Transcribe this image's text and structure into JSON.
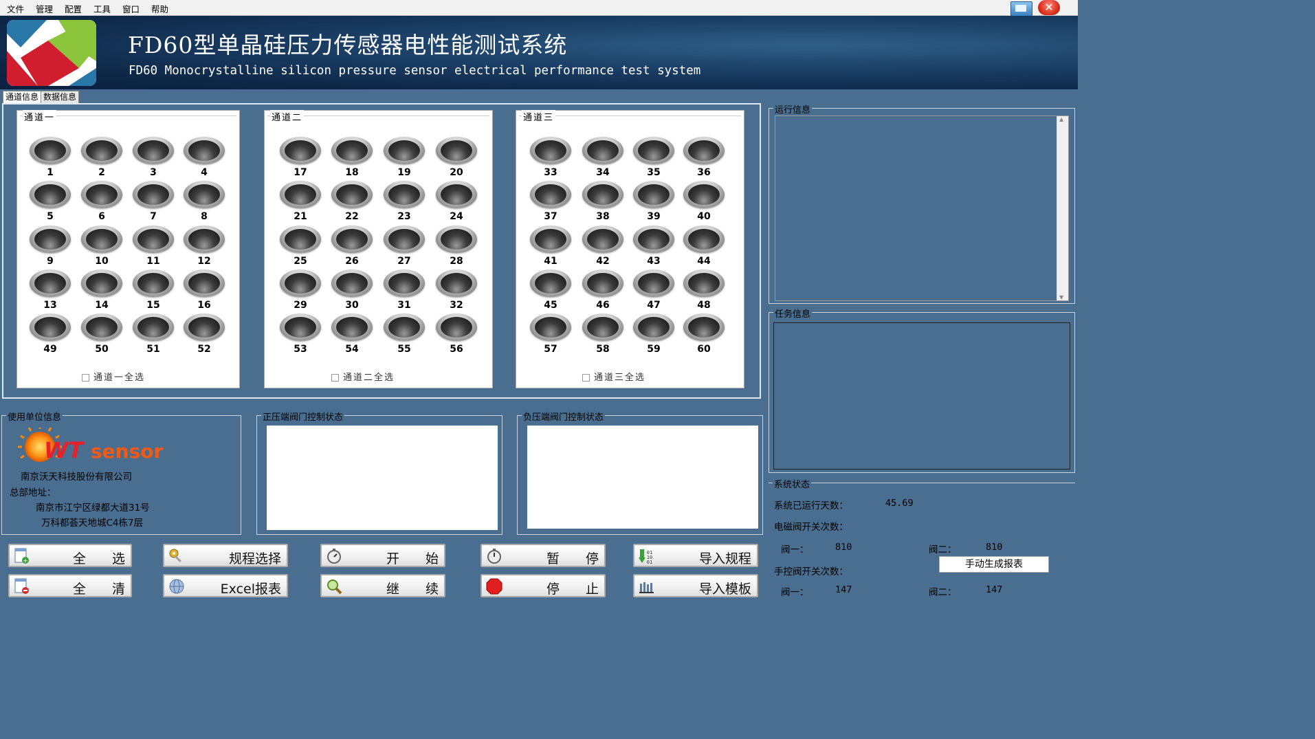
{
  "menu": [
    "文件",
    "管理",
    "配置",
    "工具",
    "窗口",
    "帮助"
  ],
  "header": {
    "title_cn": "FD60型单晶硅压力传感器电性能测试系统",
    "title_en": "FD60 Monocrystalline silicon pressure sensor electrical performance test system"
  },
  "tabs": [
    "通道信息",
    "数据信息"
  ],
  "channels": [
    {
      "title": "通道一",
      "select_all": "通道一全选",
      "sensors": [
        "1",
        "2",
        "3",
        "4",
        "5",
        "6",
        "7",
        "8",
        "9",
        "10",
        "11",
        "12",
        "13",
        "14",
        "15",
        "16",
        "49",
        "50",
        "51",
        "52"
      ]
    },
    {
      "title": "通道二",
      "select_all": "通道二全选",
      "sensors": [
        "17",
        "18",
        "19",
        "20",
        "21",
        "22",
        "23",
        "24",
        "25",
        "26",
        "27",
        "28",
        "29",
        "30",
        "31",
        "32",
        "53",
        "54",
        "55",
        "56"
      ]
    },
    {
      "title": "通道三",
      "select_all": "通道三全选",
      "sensors": [
        "33",
        "34",
        "35",
        "36",
        "37",
        "38",
        "39",
        "40",
        "41",
        "42",
        "43",
        "44",
        "45",
        "46",
        "47",
        "48",
        "57",
        "58",
        "59",
        "60"
      ]
    }
  ],
  "company": {
    "group_title": "使用单位信息",
    "logo_text": "WTsensor",
    "name": "南京沃天科技股份有限公司",
    "hq_label": "总部地址：",
    "addr1": "南京市江宁区绿都大道31号",
    "addr2": "万科都荟天地城C4栋7层"
  },
  "positive_valve": {
    "title": "正压端阀门控制状态"
  },
  "negative_valve": {
    "title": "负压端阀门控制状态"
  },
  "run_info": {
    "title": "运行信息"
  },
  "task_info": {
    "title": "任务信息"
  },
  "system_status": {
    "title": "系统状态",
    "days_label": "系统已运行天数：",
    "days_value": "45.69",
    "solenoid_label": "电磁阀开关次数：",
    "valve1_label": "阀一：",
    "valve1_value": "810",
    "valve2_label": "阀二：",
    "valve2_value": "810",
    "manual_label": "手控阀开关次数：",
    "manual_valve1_label": "阀一：",
    "manual_valve1_value": "147",
    "manual_valve2_label": "阀二：",
    "manual_valve2_value": "147",
    "report_button": "手动生成报表"
  },
  "buttons": {
    "select_all": "全　　选",
    "clear_all": "全　　清",
    "procedure": "规程选择",
    "excel": "Excel报表",
    "start": "开　　始",
    "continue": "继　　续",
    "pause": "暂　　停",
    "stop": "停　　止",
    "import_procedure": "导入规程",
    "import_template": "导入模板"
  }
}
